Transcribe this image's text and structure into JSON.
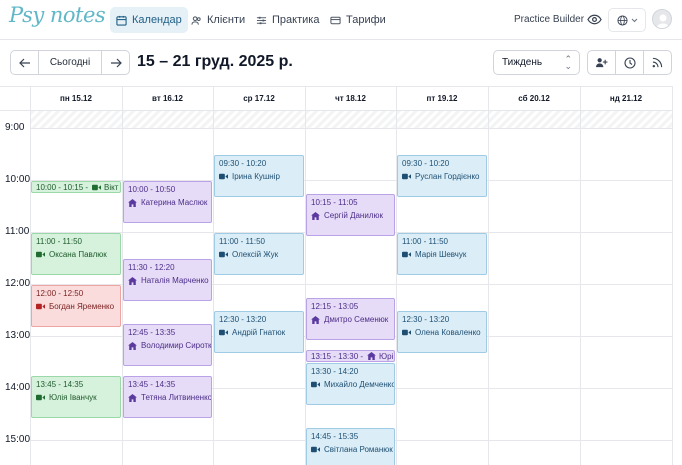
{
  "app": {
    "logo": "Psy notes"
  },
  "nav": [
    {
      "label": "Календар",
      "icon": "calendar-icon"
    },
    {
      "label": "Клієнти",
      "icon": "users-icon"
    },
    {
      "label": "Практика",
      "icon": "sliders-icon"
    },
    {
      "label": "Тарифи",
      "icon": "card-icon"
    }
  ],
  "header": {
    "practice_builder": "Practice Builder"
  },
  "toolbar": {
    "today": "Сьогодні",
    "range_title": "15 – 21 груд. 2025 р.",
    "view": "Тиждень"
  },
  "days": [
    "пн 15.12",
    "вт 16.12",
    "ср 17.12",
    "чт 18.12",
    "пт 19.12",
    "сб 20.12",
    "нд 21.12"
  ],
  "hours": [
    "9:00",
    "10:00",
    "11:00",
    "12:00",
    "13:00",
    "14:00",
    "15:00"
  ],
  "events": [
    {
      "time": "10:00 - 10:15 -",
      "name": "Вікт",
      "mode": "video",
      "color": "green"
    },
    {
      "time": "11:00 - 11:50",
      "name": "Оксана Павлюк",
      "mode": "video",
      "color": "green"
    },
    {
      "time": "12:00 - 12:50",
      "name": "Богдан Яременко",
      "mode": "video",
      "color": "red"
    },
    {
      "time": "13:45 - 14:35",
      "name": "Юлія Іванчук",
      "mode": "video",
      "color": "green"
    },
    {
      "time": "10:00 - 10:50",
      "name": "Катерина Маслюк",
      "mode": "home",
      "color": "purple"
    },
    {
      "time": "11:30 - 12:20",
      "name": "Наталія Марченко",
      "mode": "home",
      "color": "purple"
    },
    {
      "time": "12:45 - 13:35",
      "name": "Володимир Сироткін",
      "mode": "home",
      "color": "purple"
    },
    {
      "time": "13:45 - 14:35",
      "name": "Тетяна Литвиненко",
      "mode": "home",
      "color": "purple"
    },
    {
      "time": "09:30 - 10:20",
      "name": "Ірина Кушнір",
      "mode": "video",
      "color": "blue"
    },
    {
      "time": "11:00 - 11:50",
      "name": "Олексій Жук",
      "mode": "video",
      "color": "blue"
    },
    {
      "time": "12:30 - 13:20",
      "name": "Андрій Гнатюк",
      "mode": "video",
      "color": "blue"
    },
    {
      "time": "10:15 - 11:05",
      "name": "Сергій Данилюк",
      "mode": "home",
      "color": "purple"
    },
    {
      "time": "12:15 - 13:05",
      "name": "Дмитро Семенюк",
      "mode": "home",
      "color": "purple"
    },
    {
      "time": "13:15 - 13:30 -",
      "name": "Юрі",
      "mode": "home",
      "color": "purple"
    },
    {
      "time": "13:30 - 14:20",
      "name": "Михайло Демченко",
      "mode": "video",
      "color": "blue"
    },
    {
      "time": "14:45 - 15:35",
      "name": "Світлана Романюк",
      "mode": "video",
      "color": "blue"
    },
    {
      "time": "09:30 - 10:20",
      "name": "Руслан Гордієнко",
      "mode": "video",
      "color": "blue"
    },
    {
      "time": "11:00 - 11:50",
      "name": "Марія Шевчук",
      "mode": "video",
      "color": "blue"
    },
    {
      "time": "12:30 - 13:20",
      "name": "Олена Коваленко",
      "mode": "video",
      "color": "blue"
    }
  ]
}
